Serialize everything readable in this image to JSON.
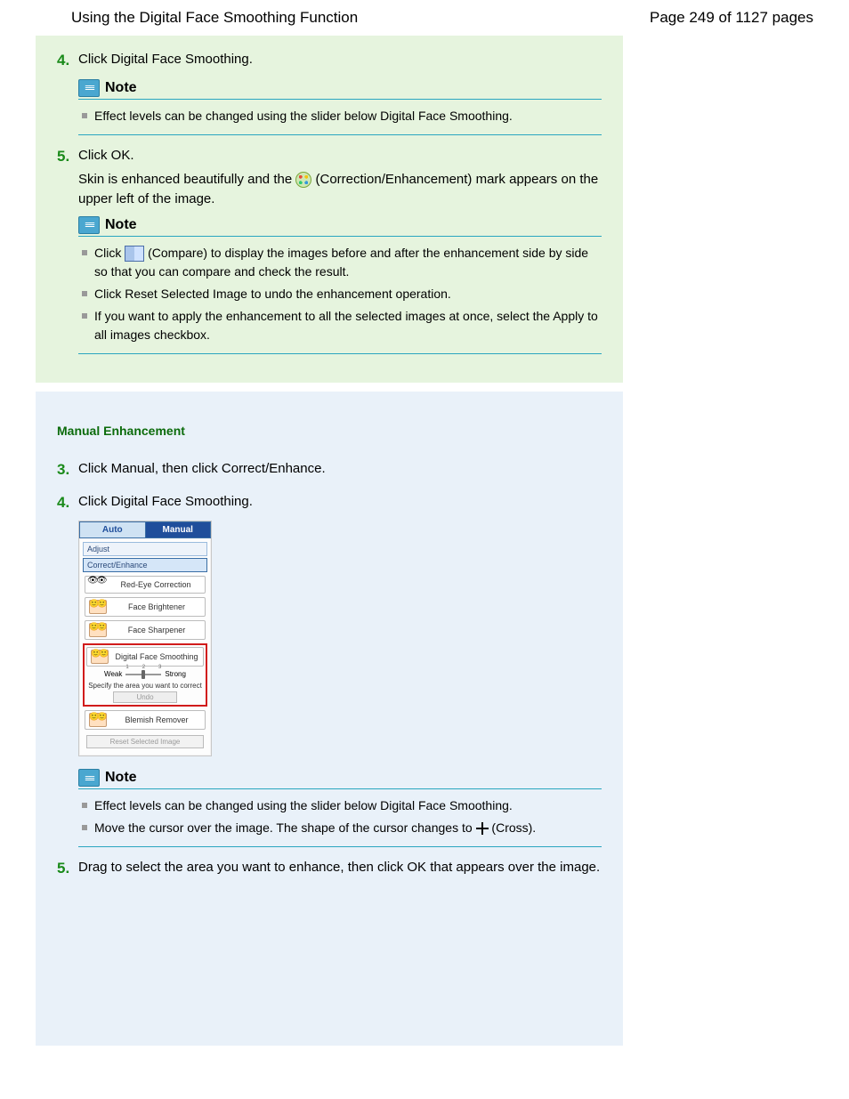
{
  "header": {
    "title": "Using the Digital Face Smoothing Function",
    "page_indicator": "Page 249 of 1127 pages"
  },
  "auto": {
    "step4": {
      "num": "4.",
      "text": "Click Digital Face Smoothing."
    },
    "note4": {
      "label": "Note",
      "items": [
        "Effect levels can be changed using the slider below Digital Face Smoothing."
      ]
    },
    "step5": {
      "num": "5.",
      "text": "Click OK.",
      "body_a": "Skin is enhanced beautifully and the ",
      "body_b": " (Correction/Enhancement) mark appears on the upper left of the image."
    },
    "note5": {
      "label": "Note",
      "item1_a": "Click ",
      "item1_b": " (Compare) to display the images before and after the enhancement side by side so that you can compare and check the result.",
      "item2": "Click Reset Selected Image to undo the enhancement operation.",
      "item3": "If you want to apply the enhancement to all the selected images at once, select the Apply to all images checkbox."
    }
  },
  "manual": {
    "heading": "Manual Enhancement",
    "step3": {
      "num": "3.",
      "text": "Click Manual, then click Correct/Enhance."
    },
    "step4": {
      "num": "4.",
      "text": "Click Digital Face Smoothing."
    },
    "note4": {
      "label": "Note",
      "item1": "Effect levels can be changed using the slider below Digital Face Smoothing.",
      "item2_a": "Move the cursor over the image. The shape of the cursor changes to ",
      "item2_b": " (Cross)."
    },
    "step5": {
      "num": "5.",
      "text": "Drag to select the area you want to enhance, then click OK that appears over the image."
    }
  },
  "panel": {
    "tab_auto": "Auto",
    "tab_manual": "Manual",
    "sub_adjust": "Adjust",
    "sub_correct": "Correct/Enhance",
    "tool_redeye": "Red-Eye Correction",
    "tool_brightener": "Face Brightener",
    "tool_sharpener": "Face Sharpener",
    "tool_smoothing": "Digital Face Smoothing",
    "slider_weak": "Weak",
    "slider_strong": "Strong",
    "tick1": "1",
    "tick2": "2",
    "tick3": "3",
    "specify": "Specify the area you want to correct",
    "undo": "Undo",
    "tool_blemish": "Blemish Remover",
    "reset": "Reset Selected Image"
  }
}
